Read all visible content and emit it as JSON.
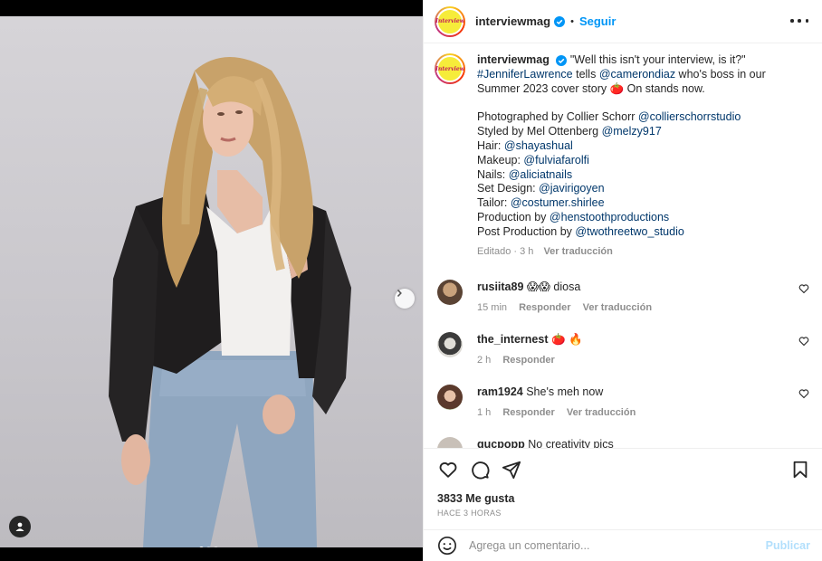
{
  "header": {
    "username": "interviewmag",
    "follow_label": "Seguir",
    "separator": "•",
    "avatar_text": "Interview"
  },
  "caption": {
    "username": "interviewmag",
    "text_parts": [
      {
        "text": "\"Well this isn't your interview, is it?\" ",
        "link": false
      },
      {
        "text": "#JenniferLawrence",
        "link": true
      },
      {
        "text": " tells ",
        "link": false
      },
      {
        "text": "@camerondiaz",
        "link": true
      },
      {
        "text": " who's boss in our Summer 2023 cover story 🍅 On stands now.",
        "link": false
      }
    ],
    "credits": [
      {
        "label": "Photographed by Collier Schorr ",
        "handle": "@collierschorrstudio"
      },
      {
        "label": "Styled by Mel Ottenberg ",
        "handle": "@melzy917"
      },
      {
        "label": "Hair: ",
        "handle": "@shayashual"
      },
      {
        "label": "Makeup: ",
        "handle": "@fulviafarolfi"
      },
      {
        "label": "Nails: ",
        "handle": "@aliciatnails"
      },
      {
        "label": "Set Design: ",
        "handle": "@javirigoyen"
      },
      {
        "label": "Tailor: ",
        "handle": "@costumer.shirlee"
      },
      {
        "label": "Production by ",
        "handle": "@henstoothproductions"
      },
      {
        "label": "Post Production by ",
        "handle": "@twothreetwo_studio"
      }
    ],
    "meta_time": "Editado · 3 h",
    "meta_translate": "Ver traducción"
  },
  "comments": [
    {
      "username": "rusiita89",
      "text": " 😱😱 diosa",
      "time": "15 min",
      "reply": "Responder",
      "translate": "Ver traducción"
    },
    {
      "username": "the_internest",
      "text": " 🍅 🔥",
      "time": "2 h",
      "reply": "Responder",
      "translate": ""
    },
    {
      "username": "ram1924",
      "text": " She's meh now",
      "time": "1 h",
      "reply": "Responder",
      "translate": "Ver traducción"
    },
    {
      "username": "gucpopp",
      "text": " No creativity pics",
      "time": "",
      "reply": "",
      "translate": ""
    }
  ],
  "stats": {
    "likes": "3833 Me gusta",
    "ago": "HACE 3 HORAS"
  },
  "add_comment": {
    "placeholder": "Agrega un comentario...",
    "publish_label": "Publicar"
  },
  "carousel": {
    "slide_count": 3,
    "active_index": 0
  },
  "colors": {
    "accent": "#0095f6",
    "link": "#00376b",
    "muted": "#8e8e8e",
    "publish_disabled": "#b2dffc"
  },
  "icons": [
    "verified-badge-icon",
    "more-options-icon",
    "next-arrow-icon",
    "user-tag-icon",
    "heart-icon",
    "comment-icon",
    "share-icon",
    "save-icon",
    "emoji-icon"
  ]
}
